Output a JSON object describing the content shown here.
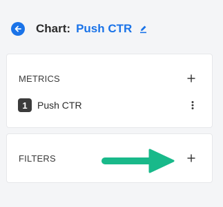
{
  "header": {
    "back_icon": "arrow-left-circle-icon",
    "prefix": "Chart:",
    "chart_name": "Push CTR",
    "edit_icon": "pencil-icon",
    "accent_color": "#1a73e8"
  },
  "metrics": {
    "title": "METRICS",
    "add_icon": "plus-icon",
    "items": [
      {
        "index": "1",
        "label": "Push CTR",
        "menu_icon": "more-vertical-icon"
      }
    ]
  },
  "filters": {
    "title": "FILTERS",
    "add_icon": "plus-icon"
  },
  "annotation": {
    "arrow_icon": "arrow-right-icon",
    "color": "#19b98a"
  }
}
